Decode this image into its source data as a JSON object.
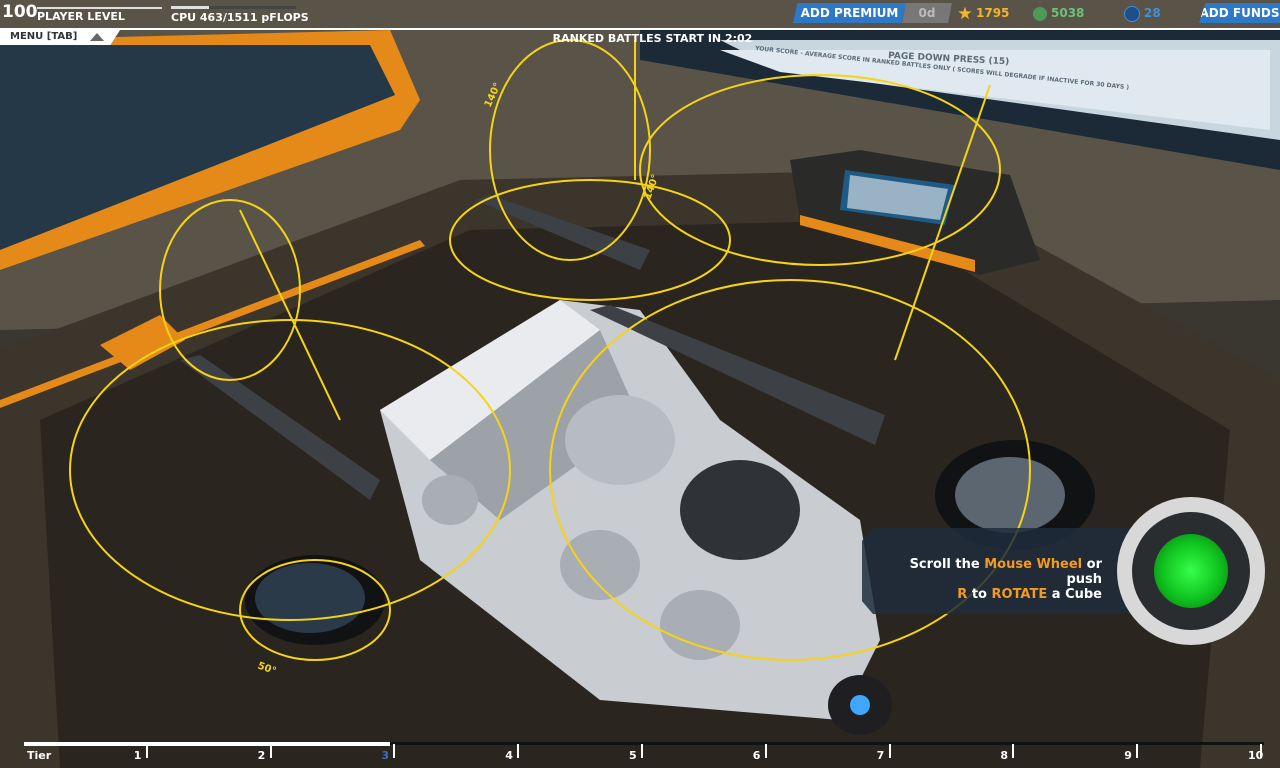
{
  "hud": {
    "player_level_number": "100",
    "player_level_label": "PLAYER LEVEL",
    "player_level_progress": 1.0,
    "cpu_label": "CPU 463/1511 pFLOPS",
    "cpu_usage": 0.306,
    "menu_label": "MENU [TAB]",
    "ranked_text": "RANKED BATTLES START IN 2:02"
  },
  "currency": {
    "add_premium": "ADD PREMIUM",
    "premium_days": "0d",
    "robits": "1795",
    "rp": "5038",
    "gc": "28",
    "add_funds": "ADD FUNDS",
    "colors": {
      "robits": "#f4b529",
      "rp": "#6cc07a",
      "gc": "#3d8fe0"
    }
  },
  "scene_text": {
    "monitor_line1": "PAGE DOWN PRESS (15)",
    "monitor_line2": "YOUR SCORE - AVERAGE SCORE IN RANKED BATTLES ONLY ( SCORES WILL DEGRADE IF INACTIVE FOR 30 DAYS )",
    "angle_a": "140°",
    "angle_b": "140°",
    "angle_c": "50°"
  },
  "tutorial": {
    "part1": "Scroll the ",
    "mouse_wheel": "Mouse Wheel",
    "part2": " or push",
    "key_r": "R",
    "part3": " to ",
    "rotate": "ROTATE",
    "part4": " a Cube"
  },
  "tier_bar": {
    "label": "Tier",
    "ticks": [
      "1",
      "2",
      "3",
      "4",
      "5",
      "6",
      "7",
      "8",
      "9",
      "10"
    ],
    "current_tier": "3"
  }
}
